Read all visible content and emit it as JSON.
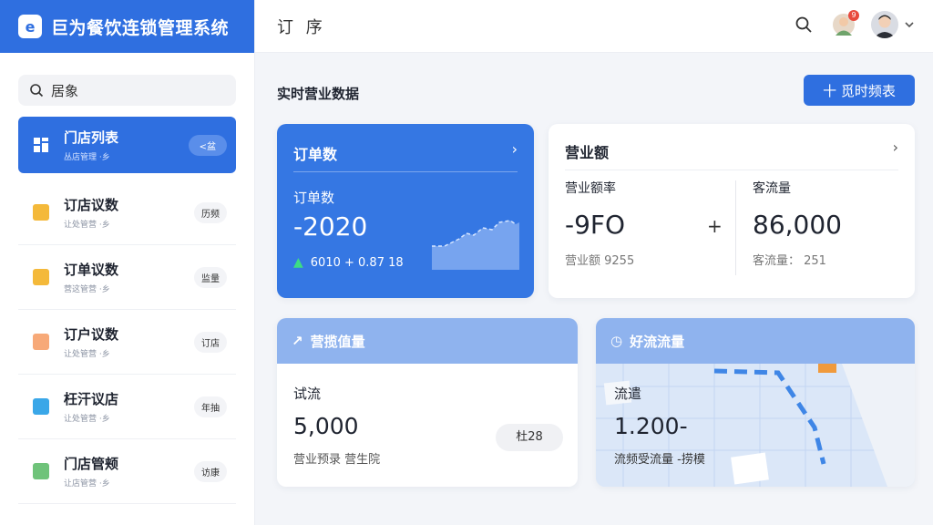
{
  "brand": {
    "title": "巨为餐饮连锁管理系统"
  },
  "header": {
    "title": "订 序",
    "notification_count": "9"
  },
  "search": {
    "placeholder": "居象"
  },
  "sidebar": {
    "items": [
      {
        "title": "门店列表",
        "sub": "丛店管理 ·乡",
        "tag": "<盆",
        "icon_color": "#ffffff",
        "active": true
      },
      {
        "title": "订店议数",
        "sub": "让处管营 ·乡",
        "tag": "历频",
        "icon_color": "#f4b93a"
      },
      {
        "title": "订单议数",
        "sub": "营这管营 ·乡",
        "tag": "监量",
        "icon_color": "#f4b93a"
      },
      {
        "title": "订户议数",
        "sub": "让处管营 ·乡",
        "tag": "订店",
        "icon_color": "#f7a978"
      },
      {
        "title": "枉汗议店",
        "sub": "让处管营 ·乡",
        "tag": "年抽",
        "icon_color": "#3aa7e8"
      },
      {
        "title": "门店管颊",
        "sub": "让店管营 ·乡",
        "tag": "访康",
        "icon_color": "#6fc37a"
      }
    ]
  },
  "main": {
    "section_title": "实时营业数据",
    "add_button": "十 觅时频表",
    "orders_card": {
      "title": "订单数",
      "label": "订单数",
      "value": "-2020",
      "trend": "6010 + 0.87 18"
    },
    "revenue_card": {
      "title": "营业额",
      "left_label": "营业额率",
      "left_value": "-9FO",
      "left_sub": "营业额 9255",
      "right_label": "客流量",
      "right_value": "86,000",
      "right_sub": "客流量： 251"
    },
    "avg_card": {
      "title": "营揽值量",
      "label": "试流",
      "value": "5,000",
      "sub": "营业预录 营生院",
      "tag": "杜28"
    },
    "flow_card": {
      "title": "好流流量",
      "label": "流遣",
      "value": "1.200-",
      "sub": "流频受流量  -捞模"
    }
  },
  "colors": {
    "primary": "#2f6fe0",
    "band": "#8fb3ee",
    "trend_up": "#3ddc84"
  }
}
